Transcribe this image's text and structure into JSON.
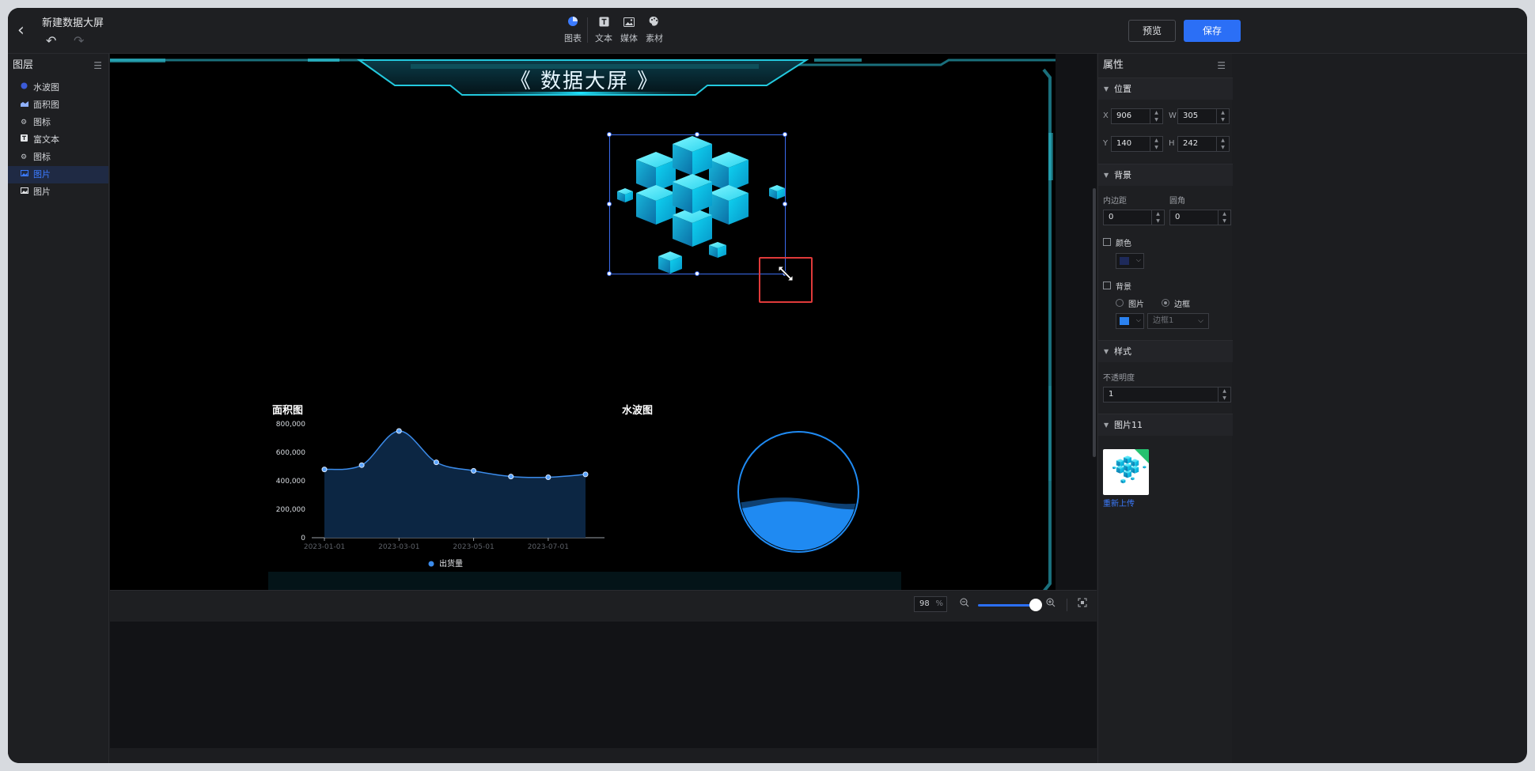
{
  "topbar": {
    "doc_title": "新建数据大屏",
    "tools": [
      {
        "label": "图表",
        "icon": "pie-chart-icon"
      },
      {
        "label": "文本",
        "icon": "text-icon"
      },
      {
        "label": "媒体",
        "icon": "image-icon"
      },
      {
        "label": "素材",
        "icon": "palette-icon"
      }
    ],
    "preview_label": "预览",
    "save_label": "保存"
  },
  "layers": {
    "title": "图层",
    "items": [
      {
        "label": "水波图",
        "icon": "waterwave-icon",
        "active": false
      },
      {
        "label": "面积图",
        "icon": "area-chart-icon",
        "active": false
      },
      {
        "label": "图标",
        "icon": "icon-glyph",
        "active": false
      },
      {
        "label": "富文本",
        "icon": "text-icon",
        "active": false
      },
      {
        "label": "图标",
        "icon": "icon-glyph",
        "active": false
      },
      {
        "label": "图片",
        "icon": "image-icon",
        "active": true
      },
      {
        "label": "图片",
        "icon": "image-icon",
        "active": false
      }
    ]
  },
  "canvas": {
    "screen_title": "《 数据大屏 》",
    "area_chart_title": "面积图",
    "water_chart_title": "水波图"
  },
  "chart_data": [
    {
      "type": "area",
      "title": "面积图",
      "x": [
        "2023-01-01",
        "2023-02-01",
        "2023-03-01",
        "2023-04-01",
        "2023-05-01",
        "2023-06-01",
        "2023-07-01",
        "2023-08-01"
      ],
      "x_tick_labels": [
        "2023-01-01",
        "2023-03-01",
        "2023-05-01",
        "2023-07-01"
      ],
      "series": [
        {
          "name": "出货量",
          "values": [
            480000,
            510000,
            750000,
            530000,
            470000,
            430000,
            425000,
            445000
          ]
        }
      ],
      "ylim": [
        0,
        800000
      ],
      "y_ticks": [
        "800,000",
        "600,000",
        "400,000",
        "200,000",
        "0"
      ],
      "legend": "bottom",
      "color": "#3b8bea"
    },
    {
      "type": "liquid",
      "title": "水波图",
      "value": 0.4,
      "color": "#1f8af2"
    }
  ],
  "bottombar": {
    "zoom_value": "98",
    "zoom_unit": "%",
    "zoom_fraction": 0.98
  },
  "props": {
    "title": "属性",
    "position": {
      "section": "位置",
      "x_label": "X",
      "x_value": "906",
      "w_label": "W",
      "w_value": "305",
      "y_label": "Y",
      "y_value": "140",
      "h_label": "H",
      "h_value": "242"
    },
    "background": {
      "section": "背景",
      "padding_label": "内边距",
      "padding_value": "0",
      "radius_label": "圆角",
      "radius_value": "0",
      "color_label": "颜色",
      "color_swatch": "#1e2a5a",
      "bg_label": "背景",
      "radio_image": "图片",
      "radio_border": "边框",
      "bg_swatch": "#2b82f0",
      "border_select": "边框1"
    },
    "style": {
      "section": "样式",
      "opacity_label": "不透明度",
      "opacity_value": "1"
    },
    "image": {
      "section": "图片11",
      "reupload_label": "重新上传"
    }
  },
  "colors": {
    "accent": "#2b6ff6",
    "cyan": "#19d6f2",
    "selection": "#3b6cf0",
    "highlight": "#e03a3a"
  }
}
